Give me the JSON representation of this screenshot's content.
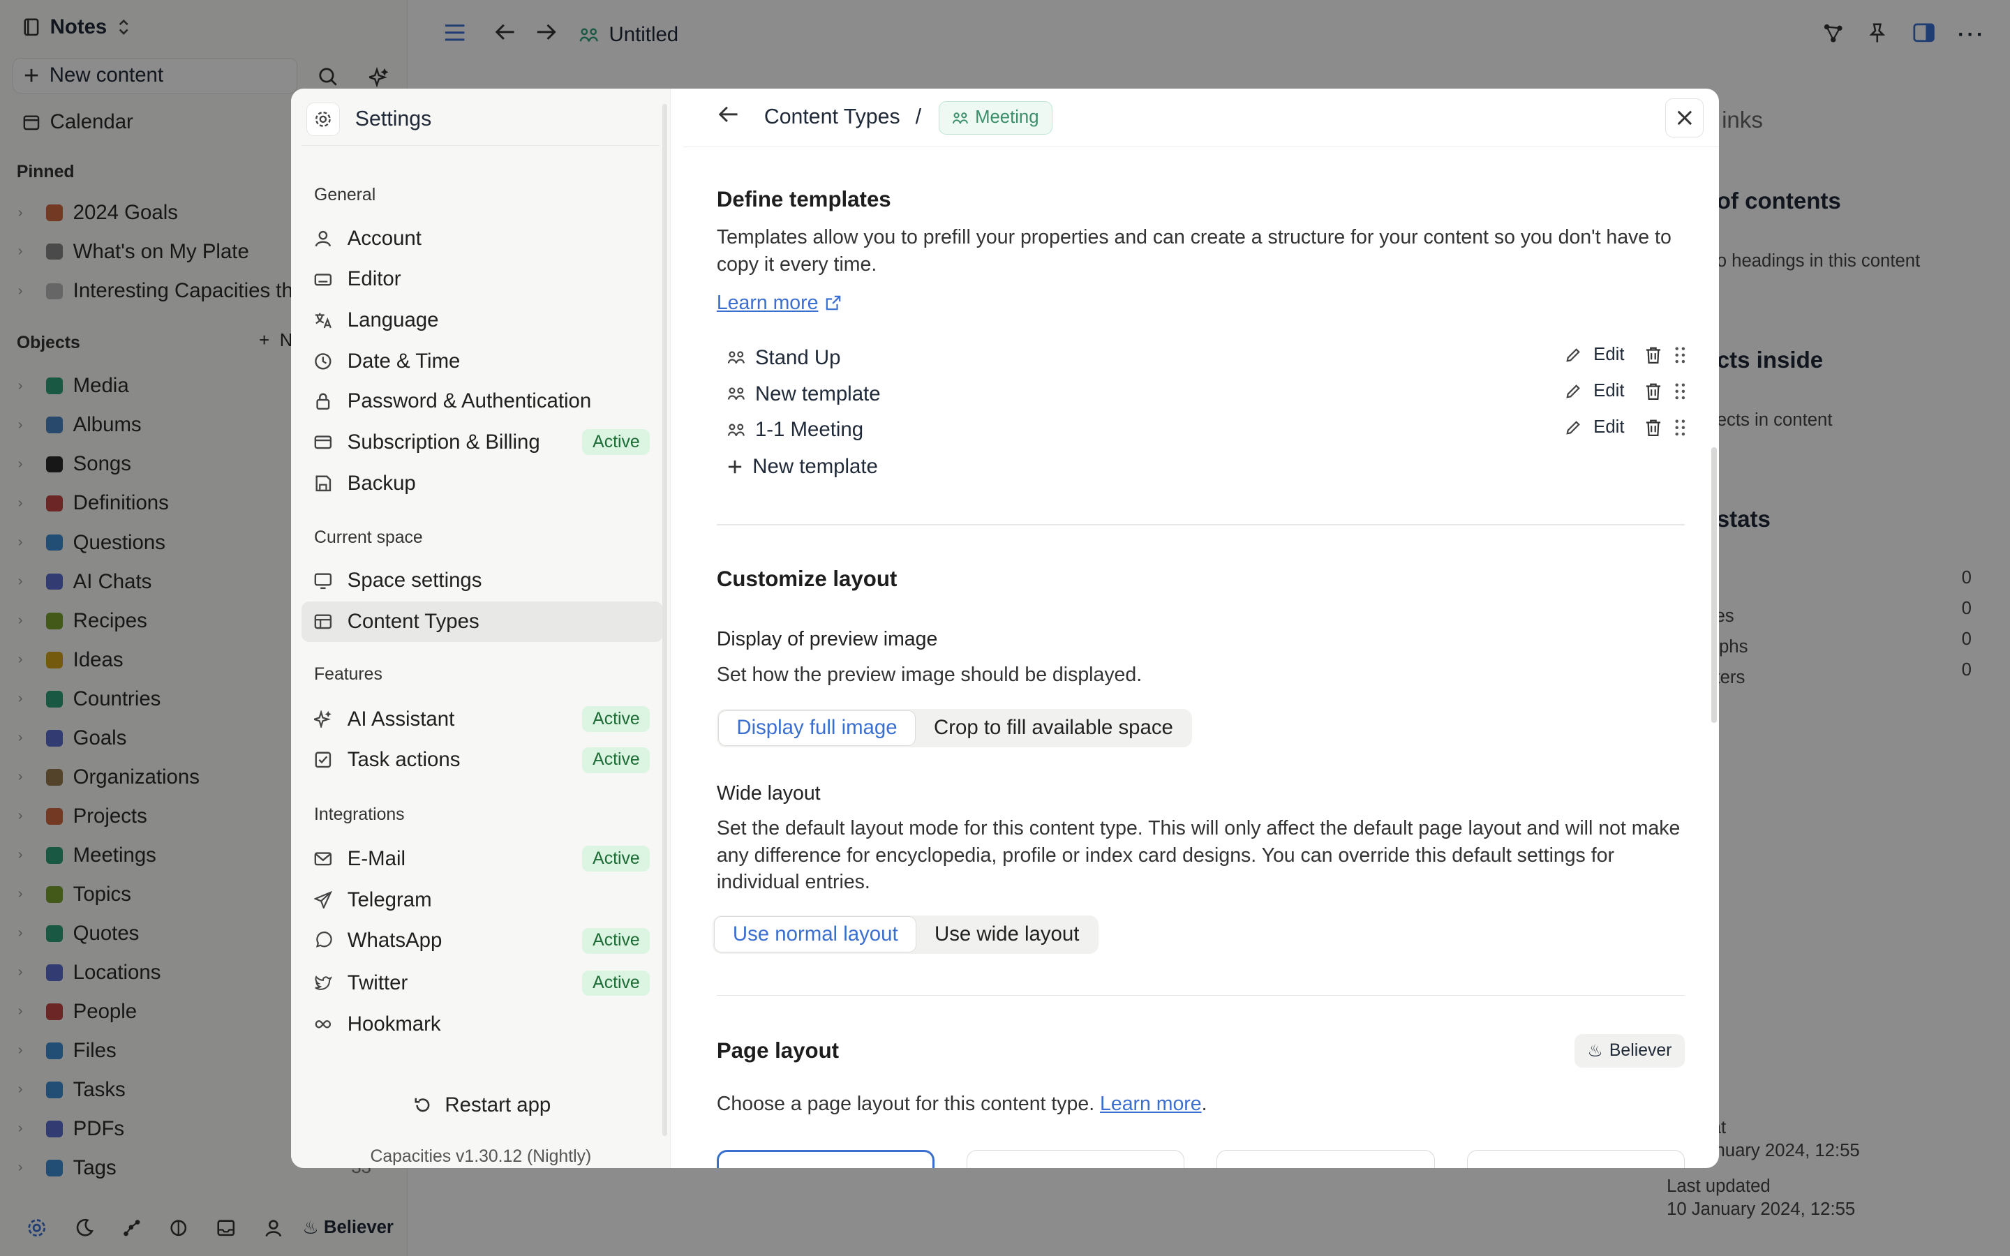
{
  "app": {
    "workspace": "Notes",
    "new_content": "New content",
    "calendar": "Calendar",
    "pinned_label": "Pinned",
    "pinned": [
      "2024 Goals",
      "What's on My Plate",
      "Interesting Capacities th"
    ],
    "objects_label": "Objects",
    "objects_new": "N",
    "objects": [
      {
        "label": "Media",
        "color": "#2fa37a"
      },
      {
        "label": "Albums",
        "color": "#4a86c5"
      },
      {
        "label": "Songs",
        "color": "#2b2b2b"
      },
      {
        "label": "Definitions",
        "color": "#c64545"
      },
      {
        "label": "Questions",
        "color": "#3f8fd6"
      },
      {
        "label": "AI Chats",
        "color": "#5b6ed1"
      },
      {
        "label": "Recipes",
        "color": "#7aa32f"
      },
      {
        "label": "Ideas",
        "color": "#d4a419"
      },
      {
        "label": "Countries",
        "color": "#2fa37a"
      },
      {
        "label": "Goals",
        "color": "#5b6ed1"
      },
      {
        "label": "Organizations",
        "color": "#9a7b4f"
      },
      {
        "label": "Projects",
        "color": "#d2693f"
      },
      {
        "label": "Meetings",
        "color": "#2fa37a"
      },
      {
        "label": "Topics",
        "color": "#7aa32f"
      },
      {
        "label": "Quotes",
        "color": "#2fa37a"
      },
      {
        "label": "Locations",
        "color": "#5b6ed1"
      },
      {
        "label": "People",
        "color": "#c64545"
      },
      {
        "label": "Files",
        "color": "#3f8fd6"
      },
      {
        "label": "Tasks",
        "color": "#3f8fd6"
      },
      {
        "label": "PDFs",
        "color": "#5b6ed1"
      },
      {
        "label": "Tags",
        "color": "#3f8fd6"
      }
    ],
    "tags_count": "33",
    "bottom_believer": "Believer"
  },
  "topbar": {
    "title": "Untitled"
  },
  "right_panel": {
    "links": "inks",
    "toc": "of contents",
    "toc_empty": "o headings in this content",
    "objects_inside": "cts inside",
    "objects_empty": "ects in content",
    "stats": "stats",
    "stat_rows": [
      {
        "label": "",
        "value": "0"
      },
      {
        "label": "nces",
        "value": "0"
      },
      {
        "label": "aphs",
        "value": "0"
      },
      {
        "label": "acters",
        "value": "0"
      }
    ],
    "created_label": "d at",
    "created_value": "January 2024, 12:55",
    "updated_label": "Last updated",
    "updated_value": "10 January 2024, 12:55"
  },
  "settings": {
    "title": "Settings",
    "groups": {
      "general": "General",
      "current_space": "Current space",
      "features": "Features",
      "integrations": "Integrations"
    },
    "general": [
      {
        "label": "Account",
        "icon": "user-icon"
      },
      {
        "label": "Editor",
        "icon": "keyboard-icon"
      },
      {
        "label": "Language",
        "icon": "language-icon"
      },
      {
        "label": "Date & Time",
        "icon": "clock-icon"
      },
      {
        "label": "Password & Authentication",
        "icon": "lock-icon"
      },
      {
        "label": "Subscription & Billing",
        "icon": "card-icon",
        "badge": "Active"
      },
      {
        "label": "Backup",
        "icon": "save-icon"
      }
    ],
    "current_space": [
      {
        "label": "Space settings",
        "icon": "monitor-icon"
      },
      {
        "label": "Content Types",
        "icon": "table-icon"
      }
    ],
    "features": [
      {
        "label": "AI Assistant",
        "icon": "sparkle-icon",
        "badge": "Active"
      },
      {
        "label": "Task actions",
        "icon": "checkbox-icon",
        "badge": "Active"
      }
    ],
    "integrations": [
      {
        "label": "E-Mail",
        "icon": "mail-icon",
        "badge": "Active"
      },
      {
        "label": "Telegram",
        "icon": "send-icon"
      },
      {
        "label": "WhatsApp",
        "icon": "whatsapp-icon",
        "badge": "Active"
      },
      {
        "label": "Twitter",
        "icon": "twitter-icon",
        "badge": "Active"
      },
      {
        "label": "Hookmark",
        "icon": "infinity-icon"
      }
    ],
    "restart": "Restart app",
    "version": "Capacities v1.30.12 (Nightly)"
  },
  "content_types": {
    "breadcrumb": "Content Types",
    "separator": "/",
    "type_chip": "Meeting",
    "define_title": "Define templates",
    "define_desc": "Templates allow you to prefill your properties and can create a structure for your content so you don't have to copy it every time.",
    "learn_more": "Learn more",
    "templates": [
      "Stand Up",
      "New template",
      "1-1 Meeting"
    ],
    "edit": "Edit",
    "new_template": "New template",
    "customize_title": "Customize layout",
    "preview_title": "Display of preview image",
    "preview_desc": "Set how the preview image should be displayed.",
    "preview_options": [
      "Display full image",
      "Crop to fill available space"
    ],
    "wide_title": "Wide layout",
    "wide_desc": "Set the default layout mode for this content type. This will only affect the default page layout and will not make any difference for encyclopedia, profile or index card designs. You can override this default settings for individual entries.",
    "wide_options": [
      "Use normal layout",
      "Use wide layout"
    ],
    "page_layout_title": "Page layout",
    "believer": "Believer",
    "page_layout_desc": "Choose a page layout for this content type.",
    "page_layout_link": "Learn more",
    "period": "."
  }
}
